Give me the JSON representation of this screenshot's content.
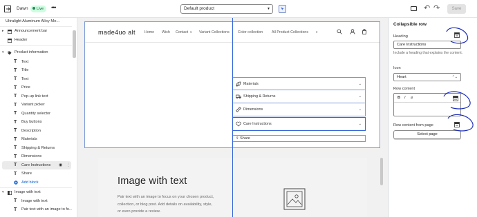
{
  "topbar": {
    "theme_name": "Dawn",
    "status": "Live",
    "template": "Default product",
    "save_label": "Save"
  },
  "sidebar": {
    "product_title": "Ultralight Aluminum Alloy Mo...",
    "rows": [
      {
        "label": "Announcement bar",
        "icon": "layout-section-icon"
      },
      {
        "label": "Header",
        "icon": "layout-section-icon"
      },
      {
        "label": "Product information",
        "icon": "tag-icon"
      },
      {
        "label": "Text",
        "icon": "text-icon"
      },
      {
        "label": "Title",
        "icon": "text-icon"
      },
      {
        "label": "Text",
        "icon": "text-icon"
      },
      {
        "label": "Price",
        "icon": "text-icon"
      },
      {
        "label": "Pop-up link text",
        "icon": "text-icon"
      },
      {
        "label": "Variant picker",
        "icon": "text-icon"
      },
      {
        "label": "Quantity selector",
        "icon": "text-icon"
      },
      {
        "label": "Buy buttons",
        "icon": "text-icon"
      },
      {
        "label": "Description",
        "icon": "text-icon"
      },
      {
        "label": "Materials",
        "icon": "leaf-icon"
      },
      {
        "label": "Shipping & Returns",
        "icon": "truck-icon"
      },
      {
        "label": "Dimensions",
        "icon": "ruler-icon"
      },
      {
        "label": "Care Instructions",
        "icon": "heart-icon"
      },
      {
        "label": "Share",
        "icon": "share-icon"
      },
      {
        "label": "Add block",
        "icon": "plus-circle-icon"
      },
      {
        "label": "Image with text",
        "icon": "layout-section-icon"
      },
      {
        "label": "Image with text",
        "icon": "text-icon"
      },
      {
        "label": "Pair text with an image to fo...",
        "icon": "text-icon"
      }
    ]
  },
  "preview": {
    "logo": "made4uo alt",
    "nav": [
      "Home",
      "Wish",
      "Contact",
      "Variant Collections",
      "Color collection",
      "All Product Collections"
    ],
    "accordions": [
      {
        "label": "Materials",
        "icon": "leaf-icon"
      },
      {
        "label": "Shipping & Returns",
        "icon": "truck-icon"
      },
      {
        "label": "Dimensions",
        "icon": "ruler-icon"
      },
      {
        "label": "Care Instructions",
        "icon": "heart-icon"
      }
    ],
    "share": "Share",
    "image_with_text": {
      "heading": "Image with text",
      "body": "Pair text with an image to focus on your chosen product, collection, or blog post. Add details on availability, style, or even provide a review."
    }
  },
  "settings": {
    "title": "Collapsible row",
    "heading_label": "Heading",
    "heading_value": "Care Instructions",
    "heading_help": "Include a heading that explains the content.",
    "icon_label": "Icon",
    "icon_value": "Heart",
    "row_content_label": "Row content",
    "rte_buttons": [
      "B",
      "I",
      "⌀"
    ],
    "page_label": "Row content from page",
    "select_page": "Select page"
  },
  "colors": {
    "accent": "#3566d8",
    "annotation": "#1a2bb8",
    "live_badge": "#cdfee1"
  }
}
